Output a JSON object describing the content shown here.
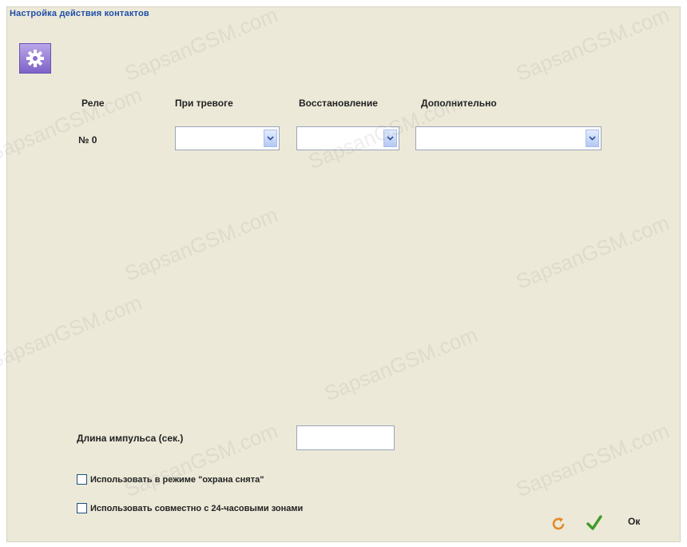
{
  "window": {
    "title": "Настройка действия контактов"
  },
  "icons": {
    "settings": "gear-icon",
    "refresh": "refresh-icon",
    "apply": "checkmark-icon"
  },
  "colors": {
    "title": "#1f4ea8",
    "background": "#ece9d8",
    "icon_box": "#8a6fd0"
  },
  "table": {
    "headers": [
      "Реле",
      "При тревоге",
      "Восстановление",
      "Дополнительно"
    ],
    "rows": [
      {
        "label": "№ 0",
        "on_alarm": "",
        "on_restore": "",
        "additional": ""
      }
    ]
  },
  "pulse": {
    "label": "Длина импульса (сек.)",
    "value": ""
  },
  "options": [
    {
      "label": "Использовать в режиме \"охрана снята\"",
      "checked": false
    },
    {
      "label": "Использовать совместно с 24-часовыми зонами",
      "checked": false
    }
  ],
  "buttons": {
    "ok_label": "Ок"
  },
  "watermark": "SapsanGSM.com"
}
